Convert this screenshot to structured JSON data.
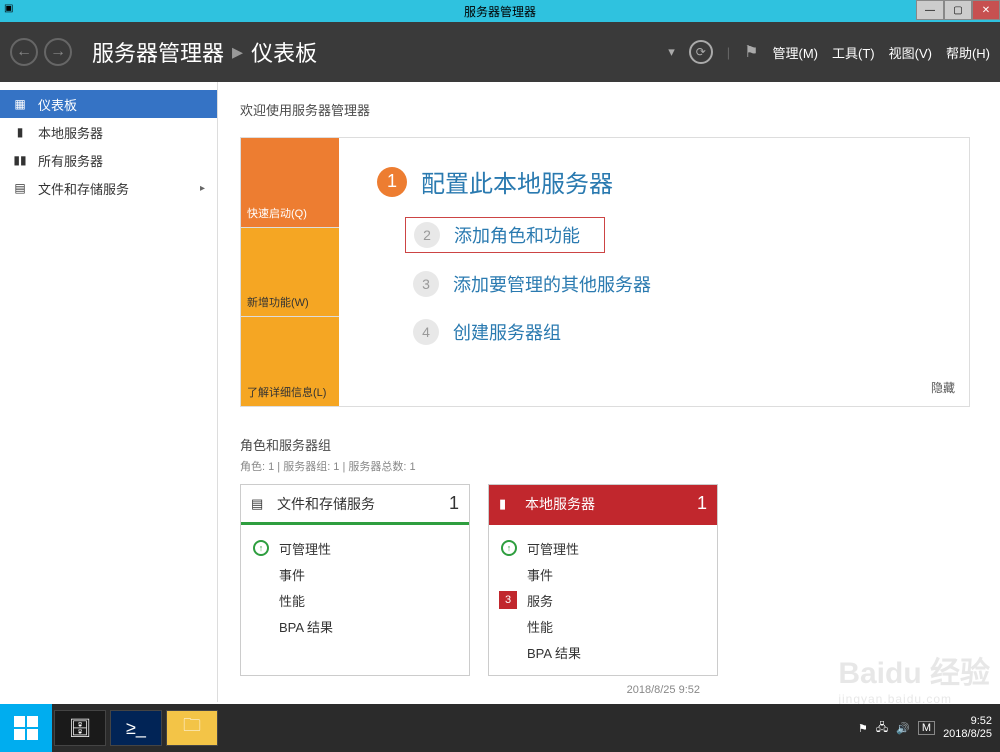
{
  "titlebar": {
    "title": "服务器管理器"
  },
  "breadcrumb": {
    "root": "服务器管理器",
    "page": "仪表板"
  },
  "menus": {
    "manage": "管理(M)",
    "tools": "工具(T)",
    "view": "视图(V)",
    "help": "帮助(H)"
  },
  "sidebar": {
    "items": [
      {
        "label": "仪表板"
      },
      {
        "label": "本地服务器"
      },
      {
        "label": "所有服务器"
      },
      {
        "label": "文件和存储服务"
      }
    ]
  },
  "welcome": {
    "heading": "欢迎使用服务器管理器",
    "tiles": {
      "quickstart": "快速启动(Q)",
      "whatsnew": "新增功能(W)",
      "learnmore": "了解详细信息(L)"
    },
    "steps": {
      "s1": "配置此本地服务器",
      "s2": "添加角色和功能",
      "s3": "添加要管理的其他服务器",
      "s4": "创建服务器组"
    },
    "hide": "隐藏"
  },
  "roles": {
    "title": "角色和服务器组",
    "subtitle": "角色: 1 | 服务器组: 1 | 服务器总数: 1",
    "tile1": {
      "title": "文件和存储服务",
      "count": "1",
      "rows": {
        "manage": "可管理性",
        "events": "事件",
        "perf": "性能",
        "bpa": "BPA 结果"
      }
    },
    "tile2": {
      "title": "本地服务器",
      "count": "1",
      "rows": {
        "manage": "可管理性",
        "events": "事件",
        "services_badge": "3",
        "services": "服务",
        "perf": "性能",
        "bpa": "BPA 结果"
      }
    },
    "timestamp": "2018/8/25 9:52"
  },
  "taskbar": {
    "time": "9:52",
    "date": "2018/8/25",
    "ime": "M"
  },
  "watermark": {
    "brand": "Baidu 经验",
    "url": "jingyan.baidu.com"
  }
}
